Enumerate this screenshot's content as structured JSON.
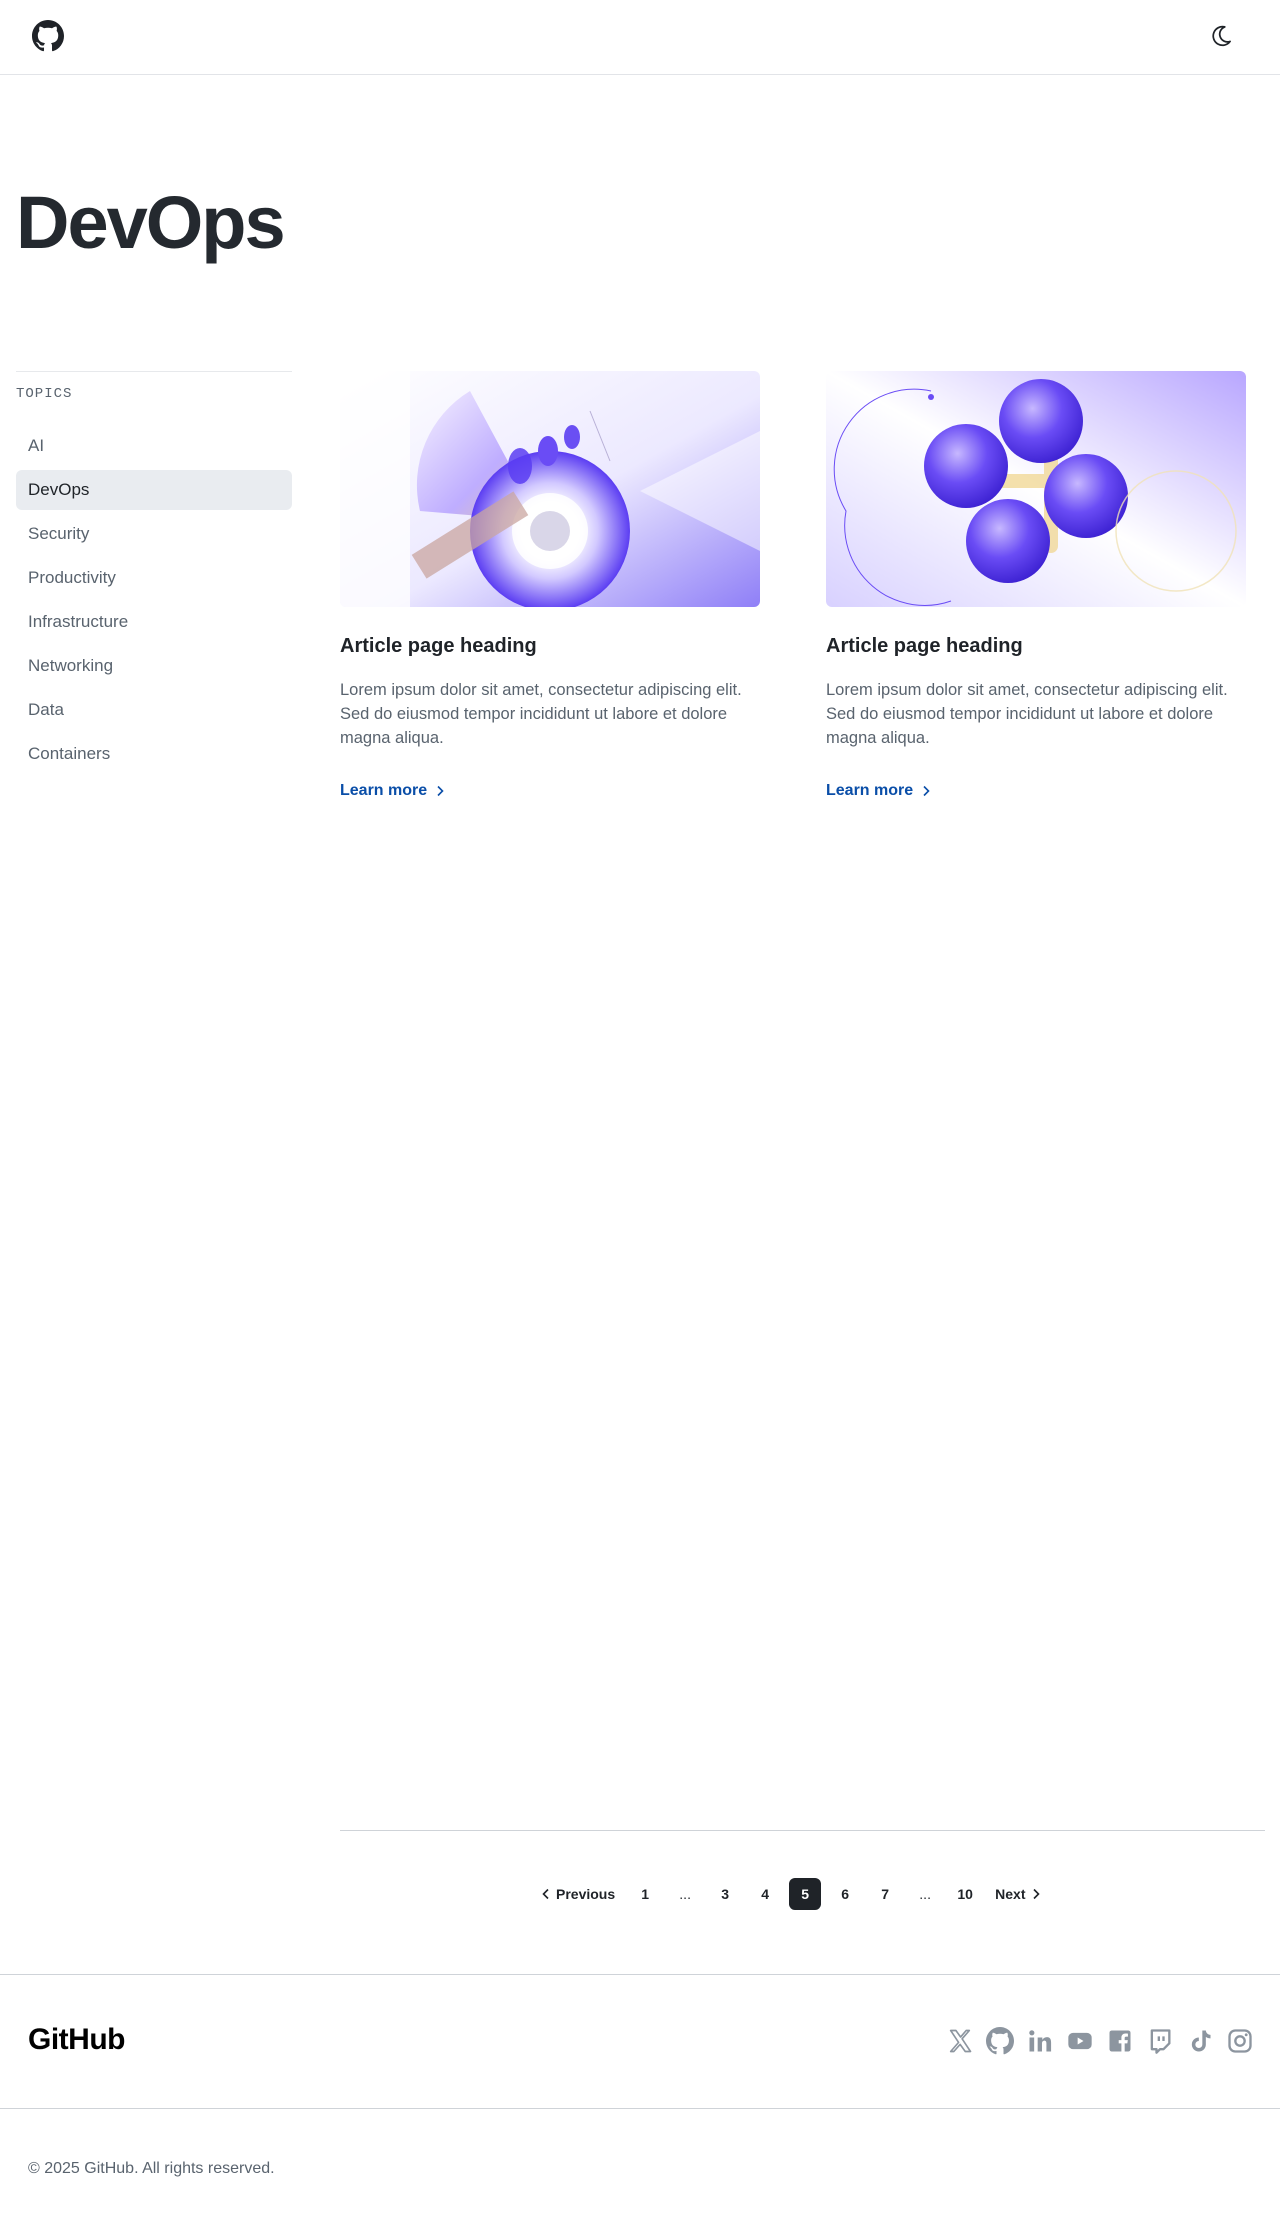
{
  "header": {
    "logo_icon": "github-mark-icon",
    "theme_icon": "moon-icon"
  },
  "page": {
    "title": "DevOps"
  },
  "sidebar": {
    "label": "TOPICS",
    "items": [
      {
        "label": "AI",
        "active": false
      },
      {
        "label": "DevOps",
        "active": true
      },
      {
        "label": "Security",
        "active": false
      },
      {
        "label": "Productivity",
        "active": false
      },
      {
        "label": "Infrastructure",
        "active": false
      },
      {
        "label": "Networking",
        "active": false
      },
      {
        "label": "Data",
        "active": false
      },
      {
        "label": "Containers",
        "active": false
      }
    ]
  },
  "articles": [
    {
      "heading": "Article page heading",
      "text": "Lorem ipsum dolor sit amet, consectetur adipiscing elit. Sed do eiusmod tempor incididunt ut labore et dolore magna aliqua.",
      "link": "Learn more"
    },
    {
      "heading": "Article page heading",
      "text": "Lorem ipsum dolor sit amet, consectetur adipiscing elit. Sed do eiusmod tempor incididunt ut labore et dolore magna aliqua.",
      "link": "Learn more"
    }
  ],
  "pagination": {
    "previous": "Previous",
    "next": "Next",
    "pages": [
      "1",
      "...",
      "3",
      "4",
      "5",
      "6",
      "7",
      "...",
      "10"
    ],
    "current": "5"
  },
  "footer": {
    "logo": "GitHub",
    "socials": [
      "x-icon",
      "github-icon",
      "linkedin-icon",
      "youtube-icon",
      "facebook-icon",
      "twitch-icon",
      "tiktok-icon",
      "instagram-icon"
    ],
    "copyright": "© 2025 GitHub. All rights reserved."
  },
  "colors": {
    "accent": "#0a4ea8",
    "text": "#1f2328",
    "muted": "#59636e",
    "active_bg": "#e9ecf0",
    "purple": "#6a4cf5"
  }
}
